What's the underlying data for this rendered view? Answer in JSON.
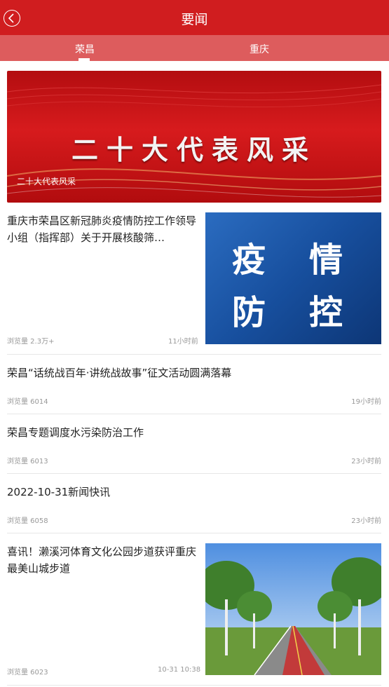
{
  "header": {
    "title": "要闻"
  },
  "tabs": [
    {
      "label": "荣昌"
    },
    {
      "label": "重庆"
    }
  ],
  "banner": {
    "headline": "二十大代表风采",
    "caption": "二十大代表风采"
  },
  "news": [
    {
      "title": "重庆市荣昌区新冠肺炎疫情防控工作领导小组（指挥部）关于开展核酸筛…",
      "views": "浏览量 2.3万+",
      "time": "11小时前",
      "thumb_text": [
        "疫",
        "情",
        "防",
        "控"
      ]
    },
    {
      "title": "荣昌“话统战百年·讲统战故事”征文活动圆满落幕",
      "views": "浏览量 6014",
      "time": "19小时前"
    },
    {
      "title": "荣昌专题调度水污染防治工作",
      "views": "浏览量 6013",
      "time": "23小时前"
    },
    {
      "title": "2022-10-31新闻快讯",
      "views": "浏览量 6058",
      "time": "23小时前"
    },
    {
      "title": "喜讯！濑溪河体育文化公园步道获评重庆最美山城步道",
      "views": "浏览量 6023",
      "time": "10-31 10:38"
    }
  ],
  "colors": {
    "header": "#d01d1f",
    "tabs": "#dd5c5d"
  },
  "icons": {
    "back": "back-arrow-icon"
  }
}
